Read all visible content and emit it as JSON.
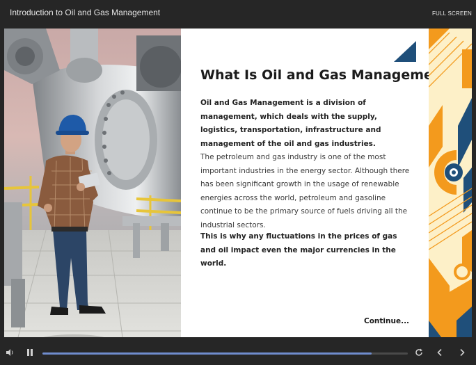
{
  "app": {
    "title": "Introduction to Oil and Gas Management",
    "fullscreen_label": "FULL SCREEN"
  },
  "slide": {
    "heading": "What Is Oil and Gas Management",
    "paragraph_1": "Oil and Gas Management is a division of management, which deals with the supply, logistics, transportation, infrastructure and management of the oil and gas industries.",
    "paragraph_2": "The petroleum and gas industry is one of the most important industries in the energy sector. Although there has been significant growth in the usage of renewable energies across the world, petroleum and gasoline continue to be the primary source of fuels driving all the industrial sectors.",
    "paragraph_3": "This is why any fluctuations in the prices of gas and oil impact even the major currencies in the world.",
    "continue_label": "Continue..."
  },
  "player": {
    "progress": 0.9,
    "icons": [
      "volume-icon",
      "pause-icon",
      "replay-icon",
      "previous-icon",
      "next-icon"
    ]
  },
  "colors": {
    "bar_background": "#262626",
    "accent_navy": "#1f4f7a",
    "accent_orange": "#f39a1d",
    "accent_cream": "#fdf0c8",
    "progress_fill": "#6f8ccd"
  }
}
